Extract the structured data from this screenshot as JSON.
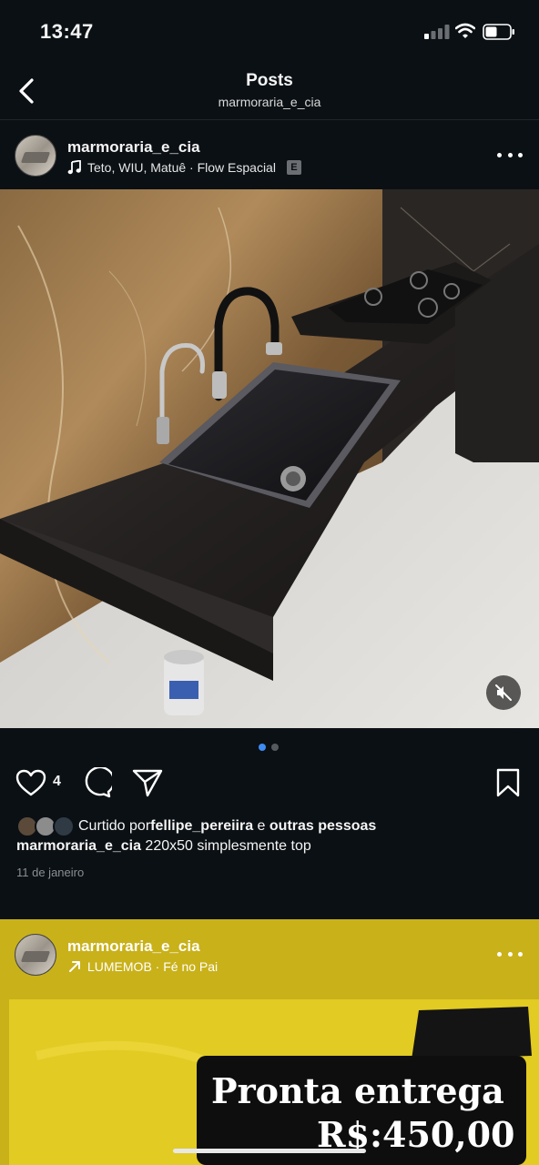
{
  "status_bar": {
    "time": "13:47"
  },
  "header": {
    "title": "Posts",
    "subtitle": "marmoraria_e_cia"
  },
  "post1": {
    "username": "marmoraria_e_cia",
    "music": "Teto, WIU, Matuê · Flow Espacial",
    "explicit_badge": "E",
    "likes_count": "4",
    "carousel": {
      "count": 2,
      "active": 1
    },
    "liked_by_prefix": "Curtido por ",
    "liked_by_user": "fellipe_pereiira",
    "liked_by_and": " e ",
    "liked_by_others": "outras pessoas",
    "caption_user": "marmoraria_e_cia",
    "caption_text": " 220x50 simplesmente top",
    "date": "11 de janeiro"
  },
  "post2": {
    "username": "marmoraria_e_cia",
    "music": "LUMEMOB · Fé no Pai",
    "promo_line1": "Pronta entrega",
    "promo_line2": "R$:450,00"
  },
  "icons": {
    "back": "chevron-left-icon",
    "music": "music-note-icon",
    "more": "more-horizontal-icon",
    "mute": "speaker-muted-icon",
    "like": "heart-icon",
    "comment": "comment-icon",
    "share": "send-icon",
    "save": "bookmark-icon"
  }
}
